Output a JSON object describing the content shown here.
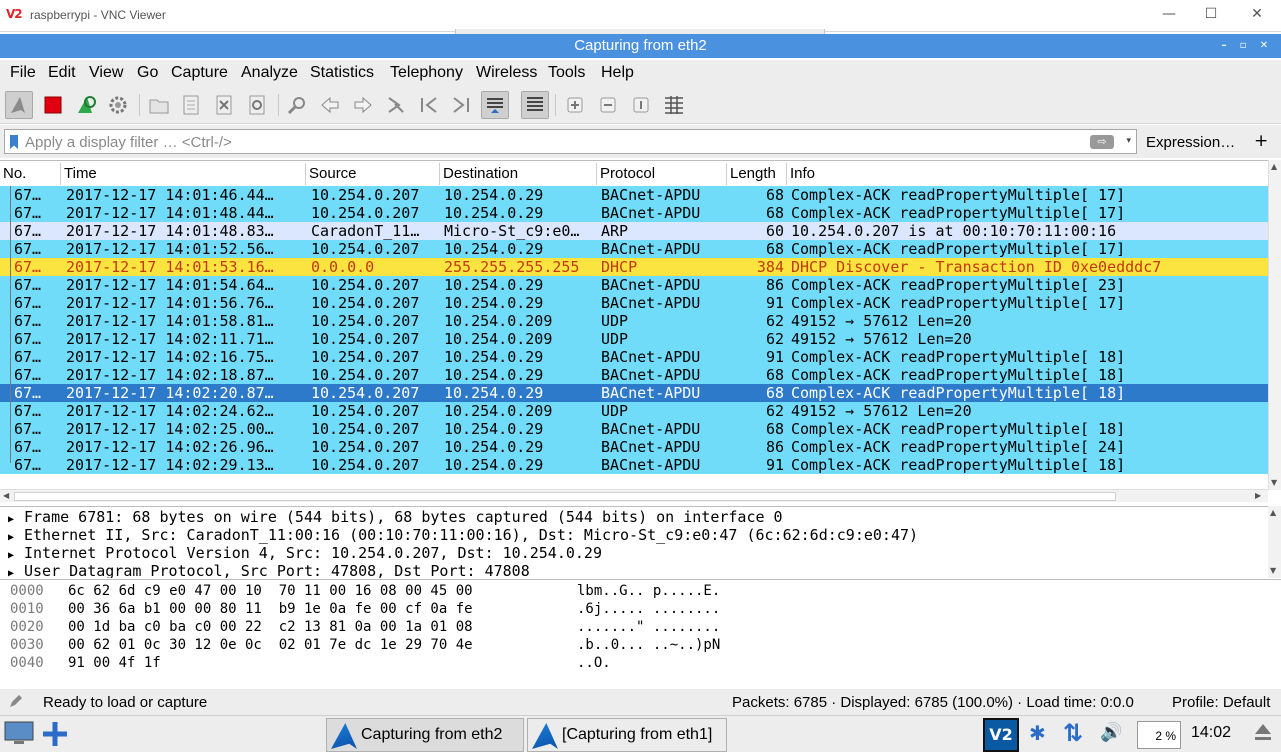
{
  "vnc": {
    "title": "raspberrypi - VNC Viewer",
    "logo": "V2",
    "minimize": "—",
    "maximize": "☐",
    "close": "✕"
  },
  "window": {
    "title": "Capturing from eth2",
    "ctl_min": "–",
    "ctl_max": "▫",
    "ctl_close": "✕"
  },
  "menu": [
    "File",
    "Edit",
    "View",
    "Go",
    "Capture",
    "Analyze",
    "Statistics",
    "Telephony",
    "Wireless",
    "Tools",
    "Help"
  ],
  "filter": {
    "placeholder": "Apply a display filter … <Ctrl-/>",
    "expression": "Expression…",
    "plus": "+",
    "apply": "⇨",
    "dropdown": "▾"
  },
  "columns": [
    "No.",
    "Time",
    "Source",
    "Destination",
    "Protocol",
    "Length",
    "Info"
  ],
  "packets": [
    {
      "type": "bac",
      "no": "67…",
      "time": "2017-12-17 14:01:46.44…",
      "src": "10.254.0.207",
      "dst": "10.254.0.29",
      "proto": "BACnet-APDU",
      "len": "68",
      "info": "Complex-ACK       readPropertyMultiple[ 17]"
    },
    {
      "type": "bac",
      "no": "67…",
      "time": "2017-12-17 14:01:48.44…",
      "src": "10.254.0.207",
      "dst": "10.254.0.29",
      "proto": "BACnet-APDU",
      "len": "68",
      "info": "Complex-ACK       readPropertyMultiple[ 17]"
    },
    {
      "type": "arp",
      "no": "67…",
      "time": "2017-12-17 14:01:48.83…",
      "src": "CaradonT_11…",
      "dst": "Micro-St_c9:e0…",
      "proto": "ARP",
      "len": "60",
      "info": "10.254.0.207 is at 00:10:70:11:00:16"
    },
    {
      "type": "bac",
      "no": "67…",
      "time": "2017-12-17 14:01:52.56…",
      "src": "10.254.0.207",
      "dst": "10.254.0.29",
      "proto": "BACnet-APDU",
      "len": "68",
      "info": "Complex-ACK       readPropertyMultiple[ 17]"
    },
    {
      "type": "dhcp",
      "no": "67…",
      "time": "2017-12-17 14:01:53.16…",
      "src": "0.0.0.0",
      "dst": "255.255.255.255",
      "proto": "DHCP",
      "len": "384",
      "info": "DHCP Discover - Transaction ID 0xe0edddc7"
    },
    {
      "type": "bac",
      "no": "67…",
      "time": "2017-12-17 14:01:54.64…",
      "src": "10.254.0.207",
      "dst": "10.254.0.29",
      "proto": "BACnet-APDU",
      "len": "86",
      "info": "Complex-ACK       readPropertyMultiple[ 23]"
    },
    {
      "type": "bac",
      "no": "67…",
      "time": "2017-12-17 14:01:56.76…",
      "src": "10.254.0.207",
      "dst": "10.254.0.29",
      "proto": "BACnet-APDU",
      "len": "91",
      "info": "Complex-ACK       readPropertyMultiple[ 17]"
    },
    {
      "type": "udp",
      "no": "67…",
      "time": "2017-12-17 14:01:58.81…",
      "src": "10.254.0.207",
      "dst": "10.254.0.209",
      "proto": "UDP",
      "len": "62",
      "info": "49152 → 57612 Len=20"
    },
    {
      "type": "udp",
      "no": "67…",
      "time": "2017-12-17 14:02:11.71…",
      "src": "10.254.0.207",
      "dst": "10.254.0.209",
      "proto": "UDP",
      "len": "62",
      "info": "49152 → 57612 Len=20"
    },
    {
      "type": "bac",
      "no": "67…",
      "time": "2017-12-17 14:02:16.75…",
      "src": "10.254.0.207",
      "dst": "10.254.0.29",
      "proto": "BACnet-APDU",
      "len": "91",
      "info": "Complex-ACK       readPropertyMultiple[ 18]"
    },
    {
      "type": "bac",
      "no": "67…",
      "time": "2017-12-17 14:02:18.87…",
      "src": "10.254.0.207",
      "dst": "10.254.0.29",
      "proto": "BACnet-APDU",
      "len": "68",
      "info": "Complex-ACK       readPropertyMultiple[ 18]"
    },
    {
      "type": "sel",
      "no": "67…",
      "time": "2017-12-17 14:02:20.87…",
      "src": "10.254.0.207",
      "dst": "10.254.0.29",
      "proto": "BACnet-APDU",
      "len": "68",
      "info": "Complex-ACK       readPropertyMultiple[ 18]"
    },
    {
      "type": "udp",
      "no": "67…",
      "time": "2017-12-17 14:02:24.62…",
      "src": "10.254.0.207",
      "dst": "10.254.0.209",
      "proto": "UDP",
      "len": "62",
      "info": "49152 → 57612 Len=20"
    },
    {
      "type": "bac",
      "no": "67…",
      "time": "2017-12-17 14:02:25.00…",
      "src": "10.254.0.207",
      "dst": "10.254.0.29",
      "proto": "BACnet-APDU",
      "len": "68",
      "info": "Complex-ACK       readPropertyMultiple[ 18]"
    },
    {
      "type": "bac",
      "no": "67…",
      "time": "2017-12-17 14:02:26.96…",
      "src": "10.254.0.207",
      "dst": "10.254.0.29",
      "proto": "BACnet-APDU",
      "len": "86",
      "info": "Complex-ACK       readPropertyMultiple[ 24]"
    },
    {
      "type": "bac",
      "no": "67…",
      "time": "2017-12-17 14:02:29.13…",
      "src": "10.254.0.207",
      "dst": "10.254.0.29",
      "proto": "BACnet-APDU",
      "len": "91",
      "info": "Complex-ACK       readPropertyMultiple[ 18]"
    }
  ],
  "details": [
    "Frame 6781: 68 bytes on wire (544 bits), 68 bytes captured (544 bits) on interface 0",
    "Ethernet II, Src: CaradonT_11:00:16 (00:10:70:11:00:16), Dst: Micro-St_c9:e0:47 (6c:62:6d:c9:e0:47)",
    "Internet Protocol Version 4, Src: 10.254.0.207, Dst: 10.254.0.29",
    "User Datagram Protocol, Src Port: 47808, Dst Port: 47808"
  ],
  "bytes": [
    {
      "off": "0000",
      "hex": "6c 62 6d c9 e0 47 00 10  70 11 00 16 08 00 45 00",
      "ascii": "lbm..G.. p.....E."
    },
    {
      "off": "0010",
      "hex": "00 36 6a b1 00 00 80 11  b9 1e 0a fe 00 cf 0a fe",
      "ascii": ".6j..... ........"
    },
    {
      "off": "0020",
      "hex": "00 1d ba c0 ba c0 00 22  c2 13 81 0a 00 1a 01 08",
      "ascii": ".......\" ........"
    },
    {
      "off": "0030",
      "hex": "00 62 01 0c 30 12 0e 0c  02 01 7e dc 1e 29 70 4e",
      "ascii": ".b..0... ..~..)pN"
    },
    {
      "off": "0040",
      "hex": "91 00 4f 1f",
      "ascii": "..O."
    }
  ],
  "status": {
    "ready": "Ready to load or capture",
    "packets": "Packets: 6785 · Displayed: 6785 (100.0%) · Load time: 0:0.0",
    "profile": "Profile: Default"
  },
  "taskbar": {
    "task1": "Capturing from eth2",
    "task2": "[Capturing from eth1]",
    "cpu": "2 %",
    "clock": "14:02",
    "vnc": "V2",
    "bt": "✱",
    "net": "⇅",
    "vol": "🔊"
  },
  "colors": {
    "bacnet": "#70dcfa",
    "arp": "#dae7ff",
    "dhcp": "#fbe340",
    "selected": "#2c7ac9",
    "title": "#4a91e0"
  }
}
